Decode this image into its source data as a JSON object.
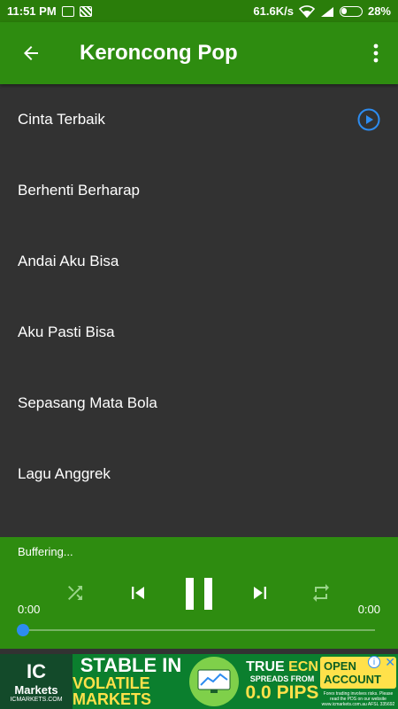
{
  "status_bar": {
    "time": "11:51 PM",
    "network_speed": "61.6K/s",
    "battery": "28%"
  },
  "app_bar": {
    "title": "Keroncong Pop",
    "back_icon": "arrow-left-icon",
    "more_icon": "more-vert-icon"
  },
  "songs": [
    {
      "label": "Cinta Terbaik",
      "playing": true
    },
    {
      "label": "Berhenti Berharap"
    },
    {
      "label": "Andai Aku Bisa"
    },
    {
      "label": "Aku Pasti Bisa"
    },
    {
      "label": "Sepasang Mata Bola"
    },
    {
      "label": "Lagu Anggrek"
    }
  ],
  "player": {
    "status": "Buffering...",
    "current_time": "0:00",
    "total_time": "0:00",
    "progress": 0
  },
  "ad": {
    "logo_ic": "IC",
    "logo_markets": "Markets",
    "logo_url": "ICMARKETS.COM",
    "headline_1": "STABLE IN",
    "headline_2": "VOLATILE MARKETS",
    "right_1a": "TRUE ",
    "right_1b": "ECN",
    "right_2": "SPREADS FROM",
    "right_3": "0.0 PIPS",
    "cta": "OPEN ACCOUNT",
    "fine_print": "Forex trading involves risks. Please read the PDS on our website www.icmarkets.com.au AFSL 335692"
  },
  "colors": {
    "app_bar": "#2e8c10",
    "list_bg": "#323232",
    "accent": "#2d8cf0"
  }
}
